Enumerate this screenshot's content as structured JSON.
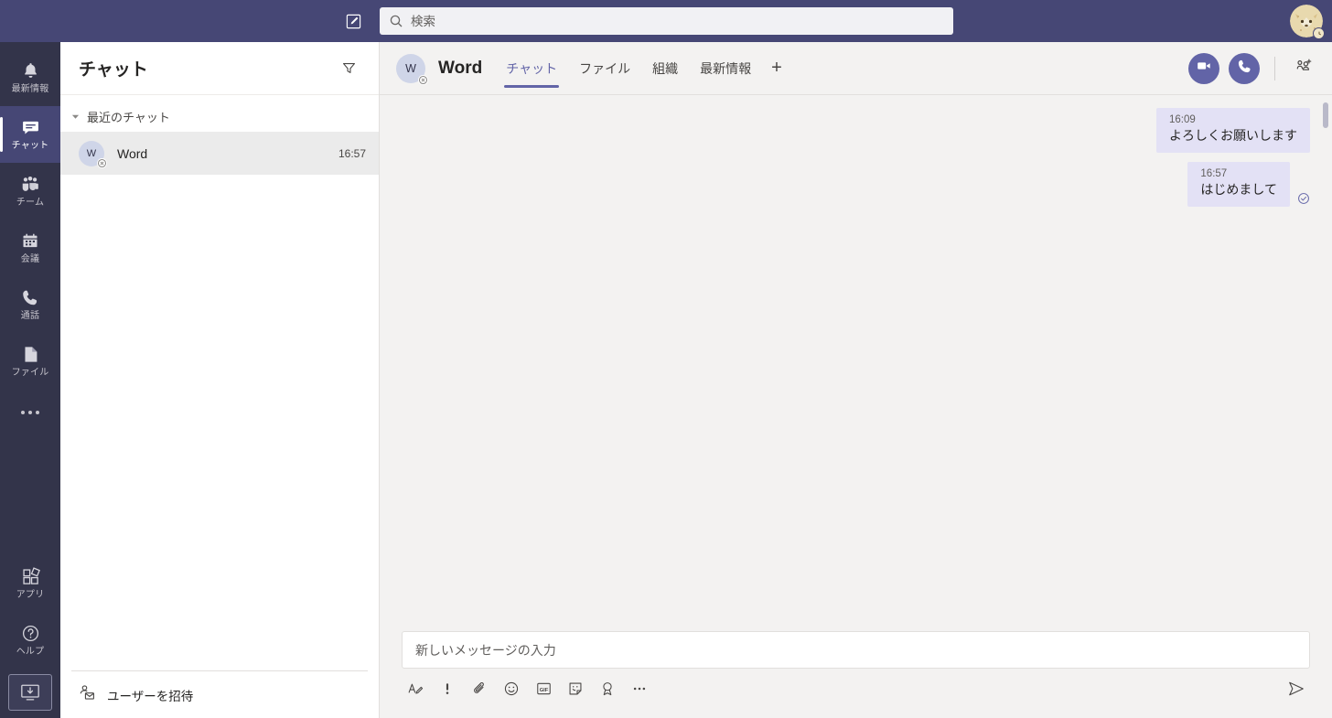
{
  "colors": {
    "brand_purple": "#6264a7",
    "topbar": "#464775",
    "rail": "#33344a",
    "bubble": "#e3e1f5",
    "canvas": "#f3f2f1"
  },
  "topbar": {
    "compose_icon": "compose-new-chat-icon",
    "search": {
      "placeholder": "検索",
      "value": "",
      "icon": "search-icon"
    },
    "avatar": {
      "name": "user-avatar",
      "badge": "status-badge"
    }
  },
  "rail": {
    "items": [
      {
        "label": "最新情報",
        "icon": "bell-icon",
        "active": false
      },
      {
        "label": "チャット",
        "icon": "chat-icon",
        "active": true
      },
      {
        "label": "チーム",
        "icon": "teams-icon",
        "active": false
      },
      {
        "label": "会議",
        "icon": "calendar-icon",
        "active": false
      },
      {
        "label": "通話",
        "icon": "phone-icon",
        "active": false
      },
      {
        "label": "ファイル",
        "icon": "files-icon",
        "active": false
      }
    ],
    "more_label": "more-apps-icon",
    "bottom": [
      {
        "label": "アプリ",
        "icon": "apps-grid-icon"
      },
      {
        "label": "ヘルプ",
        "icon": "help-question-icon"
      }
    ],
    "download_icon": "download-desktop-app-icon"
  },
  "chat_list": {
    "title": "チャット",
    "filter_icon": "filter-funnel-icon",
    "section": {
      "label": "最近のチャット",
      "chevron": "chevron-down-icon"
    },
    "rows": [
      {
        "initials": "W",
        "name": "Word",
        "time": "16:57",
        "status": "offline",
        "selected": true
      }
    ],
    "invite": {
      "label": "ユーザーを招待",
      "icon": "invite-user-icon"
    }
  },
  "conversation": {
    "header": {
      "initials": "W",
      "title": "Word",
      "status": "offline",
      "tabs": [
        {
          "label": "チャット",
          "active": true
        },
        {
          "label": "ファイル",
          "active": false
        },
        {
          "label": "組織",
          "active": false
        },
        {
          "label": "最新情報",
          "active": false
        }
      ],
      "add_tab_label": "+",
      "actions": [
        {
          "name": "video-call-button",
          "icon": "video-camera-icon"
        },
        {
          "name": "audio-call-button",
          "icon": "phone-icon"
        },
        {
          "name": "add-people-button",
          "icon": "add-person-icon"
        }
      ]
    },
    "messages": [
      {
        "time": "16:09",
        "text": "よろしくお願いします",
        "outgoing": true,
        "read_receipt": false
      },
      {
        "time": "16:57",
        "text": "はじめまして",
        "outgoing": true,
        "read_receipt": true
      }
    ],
    "compose": {
      "placeholder": "新しいメッセージの入力",
      "value": "",
      "tools": [
        {
          "name": "format-text-button",
          "icon": "format-text-icon"
        },
        {
          "name": "set-delivery-options-button",
          "icon": "exclamation-icon"
        },
        {
          "name": "attach-file-button",
          "icon": "paperclip-icon"
        },
        {
          "name": "emoji-button",
          "icon": "emoji-smiley-icon"
        },
        {
          "name": "giphy-button",
          "icon": "gif-icon"
        },
        {
          "name": "sticker-button",
          "icon": "sticker-icon"
        },
        {
          "name": "praise-button",
          "icon": "award-ribbon-icon"
        },
        {
          "name": "more-options-button",
          "icon": "ellipsis-icon"
        }
      ],
      "send": {
        "name": "send-button",
        "icon": "send-paper-plane-icon"
      }
    }
  }
}
